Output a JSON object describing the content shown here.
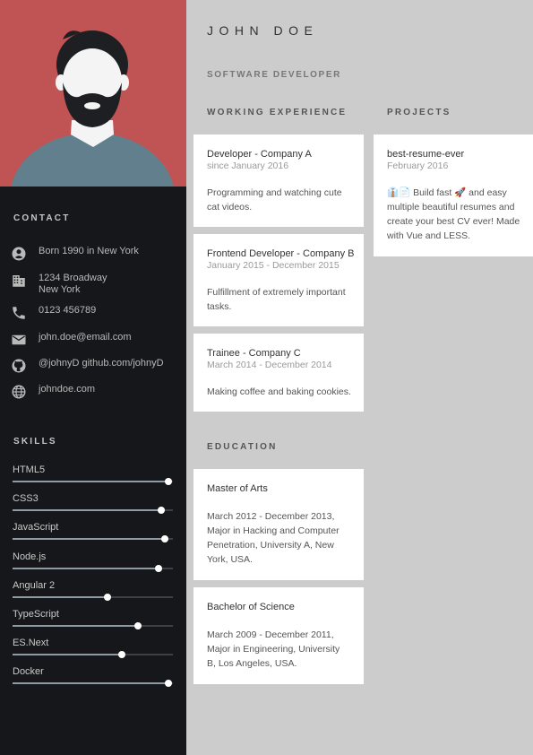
{
  "person": {
    "name": "JOHN DOE",
    "position": "SOFTWARE DEVELOPER"
  },
  "colors": {
    "avatar_bg": "#c05454",
    "sidebar_bg": "#16171b",
    "page_bg": "#cccccc",
    "card_bg": "#ffffff"
  },
  "contact": {
    "title": "CONTACT",
    "items": [
      {
        "icon": "person-icon",
        "lines": [
          "Born 1990 in New York"
        ]
      },
      {
        "icon": "building-icon",
        "lines": [
          "1234 Broadway",
          "New York"
        ]
      },
      {
        "icon": "phone-icon",
        "lines": [
          "0123 456789"
        ]
      },
      {
        "icon": "email-icon",
        "lines": [
          "john.doe@email.com"
        ]
      },
      {
        "icon": "github-icon",
        "lines": [
          "@johnyD github.com/johnyD"
        ]
      },
      {
        "icon": "globe-icon",
        "lines": [
          "johndoe.com"
        ]
      }
    ]
  },
  "skills": {
    "title": "SKILLS",
    "items": [
      {
        "name": "HTML5",
        "level": 0.97
      },
      {
        "name": "CSS3",
        "level": 0.93
      },
      {
        "name": "JavaScript",
        "level": 0.95
      },
      {
        "name": "Node.js",
        "level": 0.91
      },
      {
        "name": "Angular 2",
        "level": 0.59
      },
      {
        "name": "TypeScript",
        "level": 0.78
      },
      {
        "name": "ES.Next",
        "level": 0.68
      },
      {
        "name": "Docker",
        "level": 0.97
      }
    ]
  },
  "experience": {
    "title": "WORKING EXPERIENCE",
    "items": [
      {
        "title": "Developer - Company A",
        "date": "since January 2016",
        "description": "Programming and watching cute cat videos."
      },
      {
        "title": "Frontend Developer - Company B",
        "date": "January 2015 - December 2015",
        "description": "Fulfillment of extremely important tasks."
      },
      {
        "title": "Trainee - Company C",
        "date": "March 2014 - December 2014",
        "description": "Making coffee and baking cookies."
      }
    ]
  },
  "education": {
    "title": "EDUCATION",
    "items": [
      {
        "title": "Master of Arts",
        "description": "March 2012 - December 2013, Major in Hacking and Computer Penetration, University A, New York, USA."
      },
      {
        "title": "Bachelor of Science",
        "description": "March 2009 - December 2011, Major in Engineering, University B, Los Angeles, USA."
      }
    ]
  },
  "projects": {
    "title": "PROJECTS",
    "items": [
      {
        "title": "best-resume-ever",
        "date": "February 2016",
        "description": "👔📄 Build fast 🚀 and easy multiple beautiful resumes and create your best CV ever! Made with Vue and LESS."
      }
    ]
  }
}
